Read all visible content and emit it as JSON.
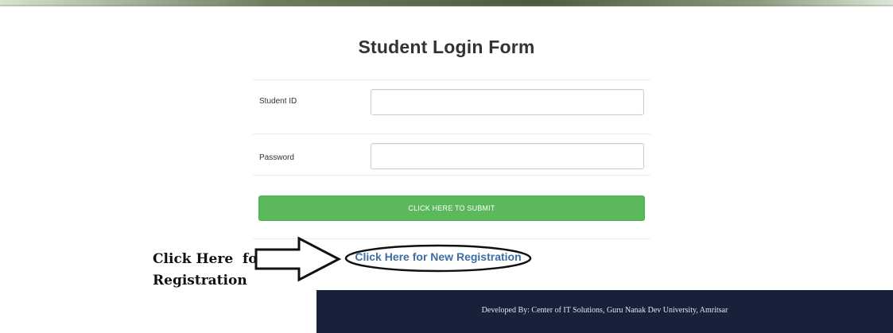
{
  "page": {
    "title": "Student Login Form"
  },
  "form": {
    "student_id_label": "Student ID",
    "student_id_value": "",
    "password_label": "Password",
    "password_value": "",
    "submit_label": "CLICK HERE TO SUBMIT"
  },
  "registration": {
    "link_label": "Click Here for New Registration"
  },
  "annotation": {
    "line1": "Click Here  for",
    "line2": "Registration"
  },
  "footer": {
    "text": "Developed By: Center of IT Solutions, Guru Nanak Dev University, Amritsar"
  },
  "colors": {
    "submit_button": "#5cb85c",
    "link": "#3a6ea5",
    "footer_background": "#17213a"
  }
}
